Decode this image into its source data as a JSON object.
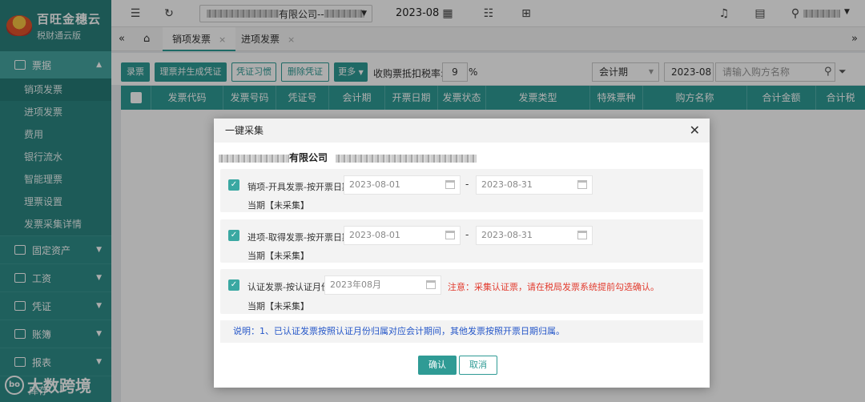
{
  "app": {
    "name": "百旺金穗云",
    "subtitle": "税财通云版"
  },
  "sidebar": {
    "groups": [
      {
        "label": "票据",
        "expanded": true,
        "items": [
          "销项发票",
          "进项发票",
          "费用",
          "银行流水",
          "智能理票",
          "理票设置",
          "发票采集详情"
        ]
      },
      {
        "label": "固定资产"
      },
      {
        "label": "工资"
      },
      {
        "label": "凭证"
      },
      {
        "label": "账簿"
      },
      {
        "label": "报表"
      },
      {
        "label": "库存"
      }
    ]
  },
  "topbar": {
    "company_suffix": "有限公司--",
    "period": "2023-08"
  },
  "tabs": [
    "销项发票",
    "进项发票"
  ],
  "toolbar": {
    "buttons": [
      "录票",
      "理票并生成凭证",
      "凭证习惯",
      "删除凭证",
      "更多"
    ],
    "tax_label": "收购票抵扣税率:",
    "tax_value": "9",
    "tax_unit": "%",
    "period_select": "会计期",
    "period_value": "2023-08",
    "search_placeholder": "请输入购方名称"
  },
  "table": {
    "columns": [
      "发票代码",
      "发票号码",
      "凭证号",
      "会计期",
      "开票日期",
      "发票状态",
      "发票类型",
      "特殊票种",
      "购方名称",
      "合计金额",
      "合计税"
    ]
  },
  "modal": {
    "title": "一键采集",
    "company_suffix": "有限公司",
    "sections": [
      {
        "label": "销项-开具发票-按开票日期:",
        "start": "2023-08-01",
        "end": "2023-08-31",
        "status": "当期【未采集】"
      },
      {
        "label": "进项-取得发票-按开票日期:",
        "start": "2023-08-01",
        "end": "2023-08-31",
        "status": "当期【未采集】"
      },
      {
        "label": "认证发票-按认证月份:",
        "month": "2023年08月",
        "notice": "注意：采集认证票，请在税局发票系统提前勾选确认。",
        "status": "当期【未采集】"
      }
    ],
    "explanation": "说明：1、已认证发票按照认证月份归属对应会计期间，其他发票按照开票日期归属。",
    "confirm_label": "确认",
    "cancel_label": "取消"
  },
  "watermark": {
    "text": "大数跨境"
  },
  "colors": {
    "primary": "#2f9b95",
    "sidebar": "#2f8e8a",
    "notice": "#e23b2e",
    "explain": "#2456c8"
  }
}
